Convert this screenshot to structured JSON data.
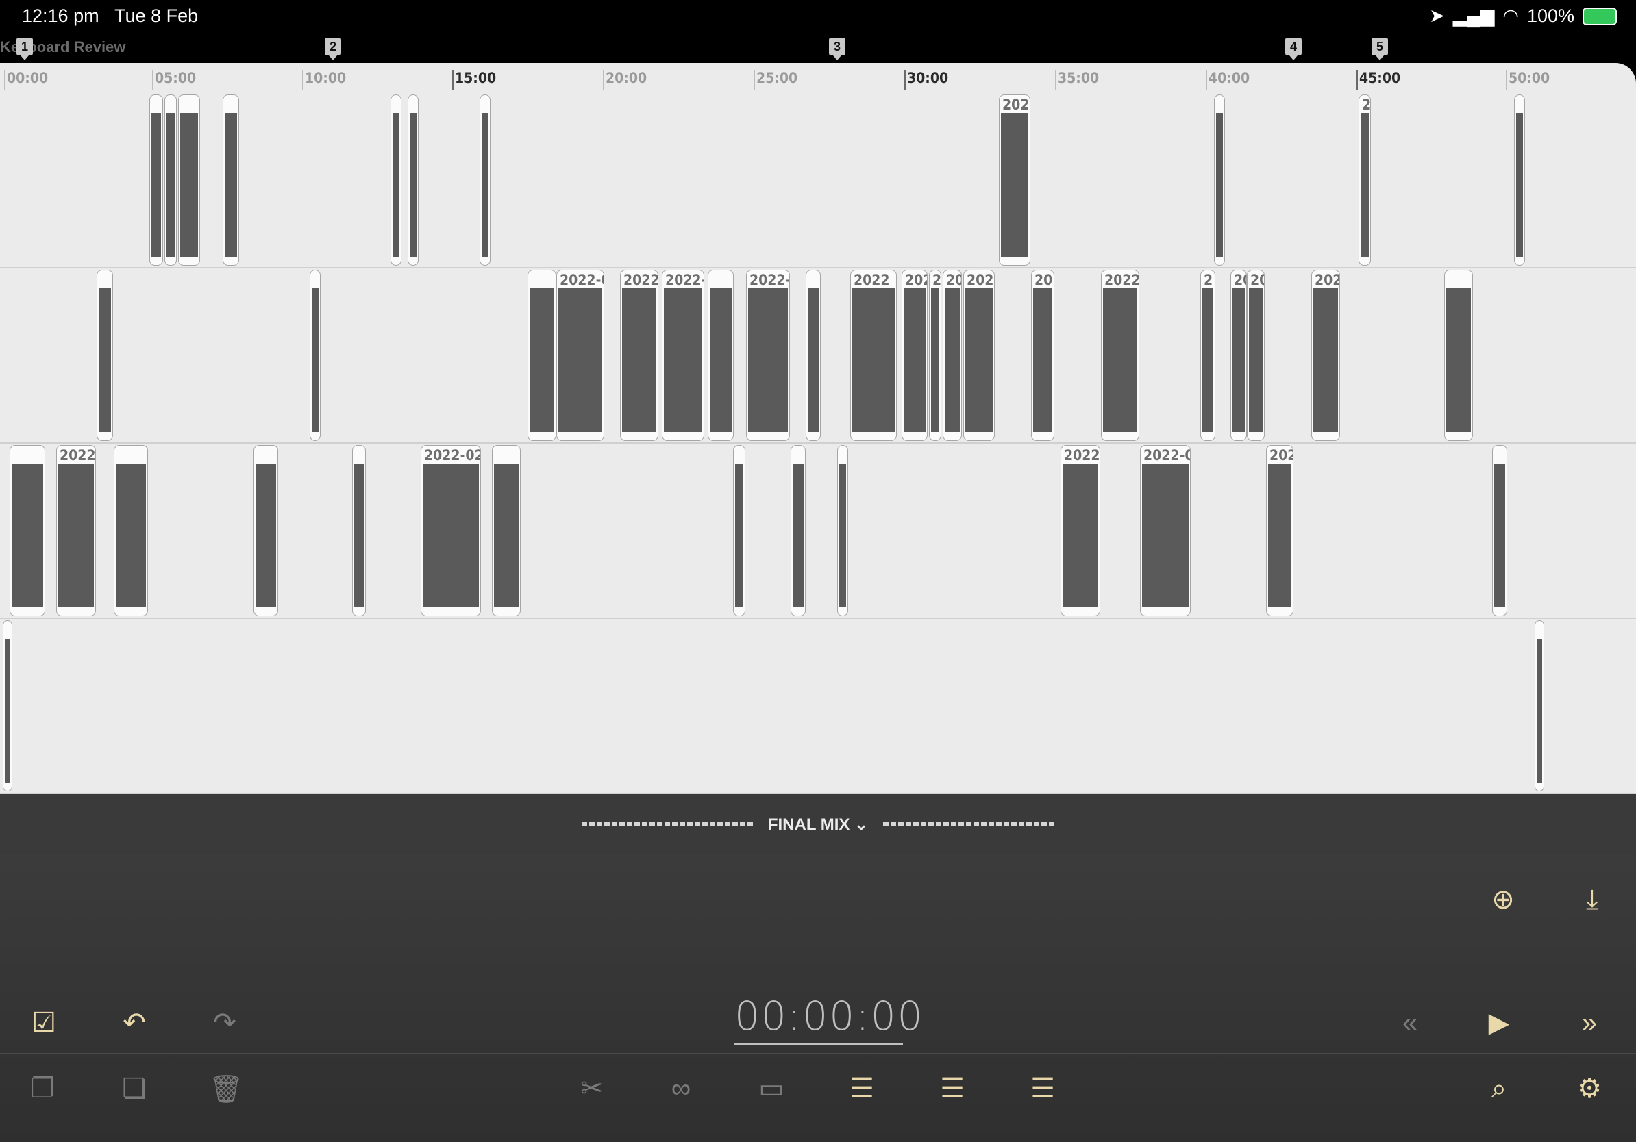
{
  "status_bar": {
    "time": "12:16 pm",
    "date": "Tue 8 Feb",
    "battery": "100%"
  },
  "project": {
    "title": "Keyboard Review"
  },
  "markers": [
    "1",
    "2",
    "3",
    "4",
    "5"
  ],
  "ruler": {
    "ticks": [
      "00:00",
      "05:00",
      "10:00",
      "15:00",
      "20:00",
      "25:00",
      "30:00",
      "35:00",
      "40:00",
      "45:00",
      "50:00"
    ]
  },
  "clip_labels": {
    "lane1": [
      "2022",
      "2"
    ],
    "lane2": [
      "2022-0",
      "2022-",
      "2022-",
      "2022-(",
      "2022",
      "202",
      "2",
      "20",
      "2022",
      "20",
      "2022-",
      "2",
      "20",
      "20",
      "202"
    ],
    "lane3": [
      "2022",
      "2022-02-",
      "2022-",
      "2022-0",
      "202"
    ]
  },
  "mix": {
    "name": "FINAL MIX"
  },
  "transport": {
    "timecode": "00:00:00"
  },
  "colors": {
    "accent": "#e8d8aa",
    "timeline_bg": "#ebebeb",
    "panel_bg": "#3a3a3a"
  },
  "icons": {
    "add": "plus-circle-icon",
    "export": "export-icon",
    "doc": "document-check-icon",
    "undo": "undo-icon",
    "redo": "redo-icon",
    "rewind": "rewind-icon",
    "play": "play-icon",
    "forward": "fast-forward-icon",
    "copy": "copy-icon",
    "paste": "paste-icon",
    "delete": "trash-icon",
    "split": "split-icon",
    "link": "link-icon",
    "unlink": "unlink-icon",
    "list_text": "list-text-icon",
    "list_add": "list-add-icon",
    "list": "list-icon",
    "search": "search-icon",
    "settings": "settings-icon"
  }
}
